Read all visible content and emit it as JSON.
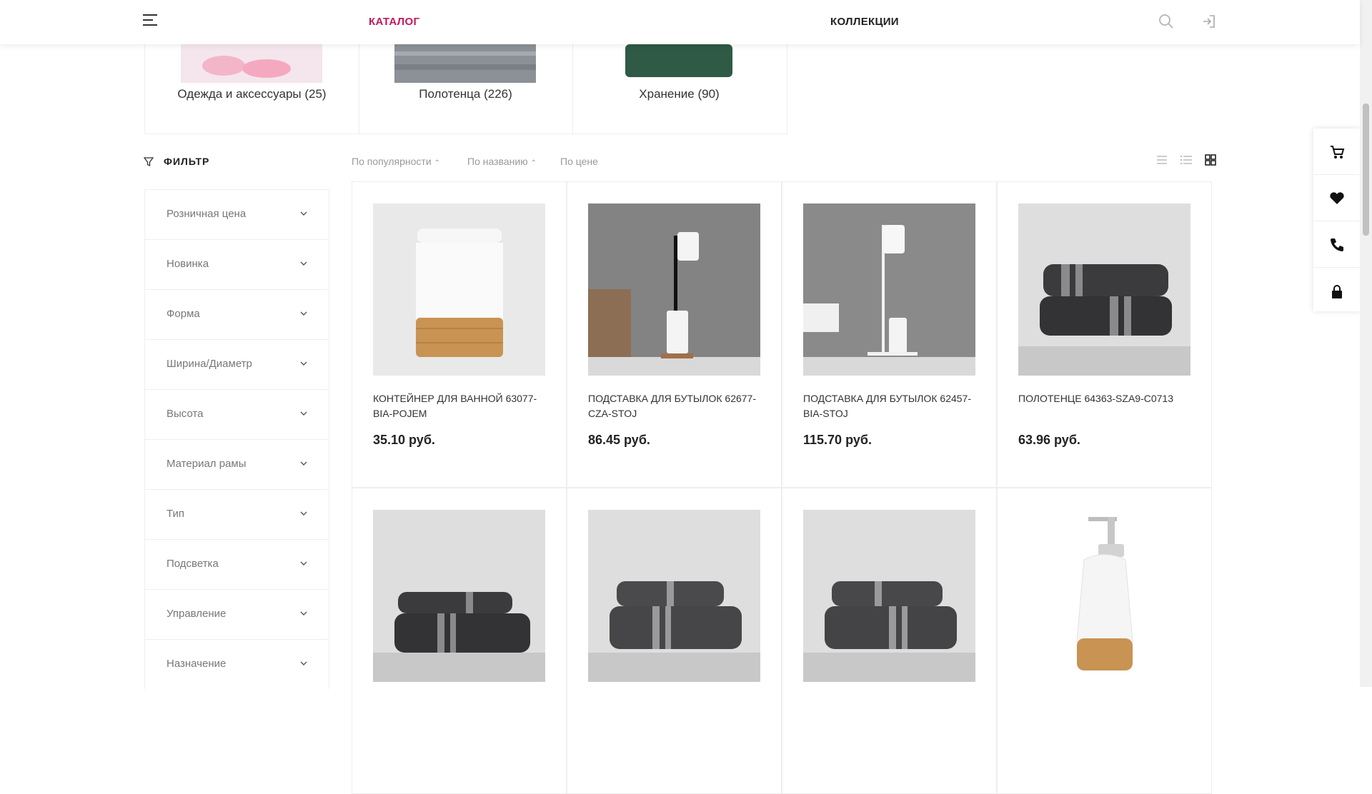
{
  "header": {
    "nav_catalog": "КАТАЛОГ",
    "nav_collections": "КОЛЛЕКЦИИ",
    "accent_color": "#c2185b"
  },
  "categories": [
    {
      "label": "Одежда и аксессуары (25)"
    },
    {
      "label": "Полотенца (226)"
    },
    {
      "label": "Хранение (90)"
    }
  ],
  "filter": {
    "title": "ФИЛЬТР",
    "items": [
      "Розничная цена",
      "Новинка",
      "Форма",
      "Ширина/Диаметр",
      "Высота",
      "Материал рамы",
      "Тип",
      "Подсветка",
      "Управление",
      "Назначение"
    ]
  },
  "sort": {
    "popularity": "По популярности",
    "name": "По названию",
    "price": "По цене"
  },
  "products": [
    {
      "name": "КОНТЕЙНЕР ДЛЯ ВАННОЙ 63077-BIA-POJEM",
      "price": "35.10 руб."
    },
    {
      "name": "ПОДСТАВКА ДЛЯ БУТЫЛОК 62677-CZA-STOJ",
      "price": "86.45 руб."
    },
    {
      "name": "ПОДСТАВКА ДЛЯ БУТЫЛОК 62457-BIA-STOJ",
      "price": "115.70 руб."
    },
    {
      "name": "ПОЛОТЕНЦЕ 64363-SZA9-C0713",
      "price": "63.96 руб."
    },
    {
      "name": "",
      "price": ""
    },
    {
      "name": "",
      "price": ""
    },
    {
      "name": "",
      "price": ""
    },
    {
      "name": "",
      "price": ""
    }
  ]
}
